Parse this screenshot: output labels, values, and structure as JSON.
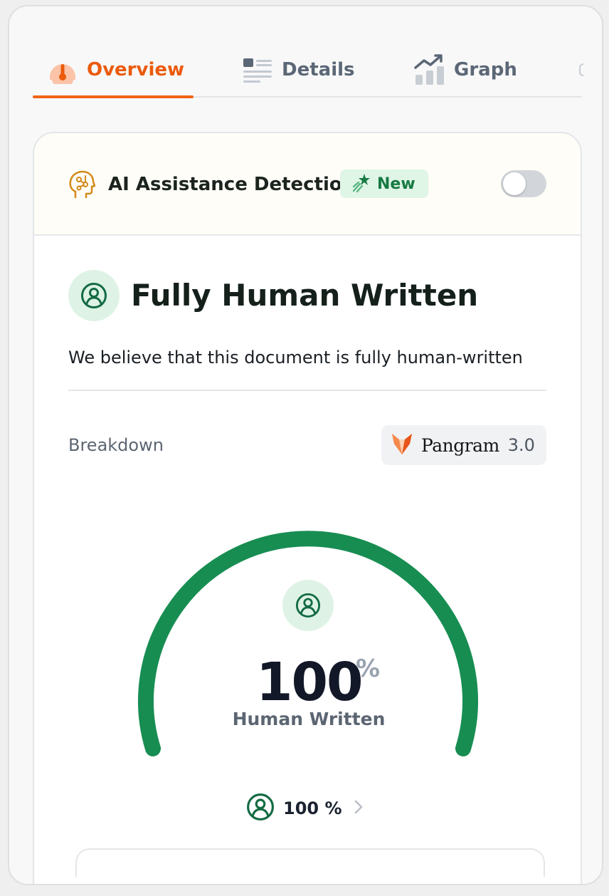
{
  "tabs": [
    {
      "label": "Overview",
      "icon": "gauge-icon",
      "active": true
    },
    {
      "label": "Details",
      "icon": "details-list-icon",
      "active": false
    },
    {
      "label": "Graph",
      "icon": "graph-icon",
      "active": false
    }
  ],
  "ai_detection": {
    "title": "AI Assistance Detection",
    "badge_label": "New",
    "toggle_on": false
  },
  "result": {
    "title": "Fully Human Written",
    "description": "We believe that this document is fully human-written"
  },
  "breakdown": {
    "label": "Breakdown",
    "model_name": "Pangram",
    "model_version": "3.0"
  },
  "gauge": {
    "value": "100",
    "unit": "%",
    "label": "Human Written",
    "fraction": 1.0
  },
  "summary": {
    "value": "100 %"
  },
  "colors": {
    "accent": "#f06416",
    "human_green": "#178d52",
    "badge_green_bg": "#dff5e6"
  }
}
